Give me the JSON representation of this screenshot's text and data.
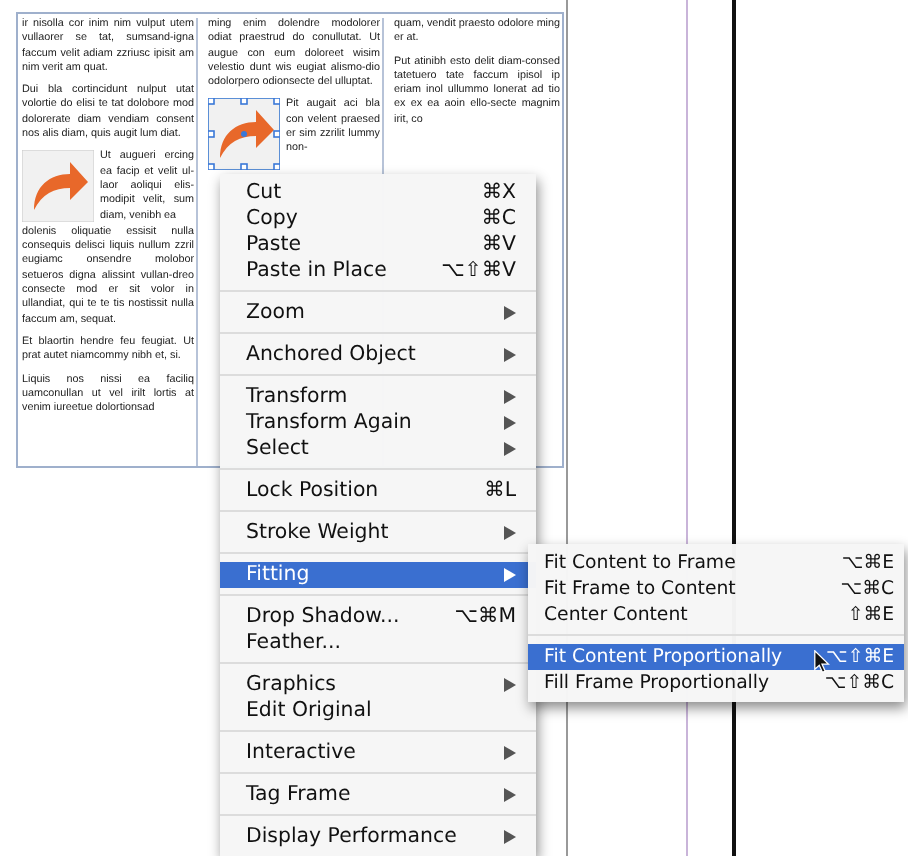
{
  "document": {
    "columns": [
      {
        "blocks": [
          {
            "kind": "text",
            "text": "ir nisolla cor inim nim vulput utem vullaorer se tat, sumsand-igna faccum velit adiam zzriusc ipisit am nim verit am quat."
          },
          {
            "kind": "text",
            "text": "Dui bla cortincidunt nulput utat volortie do elisi te tat dolobore mod dolorerate diam vendiam consent nos alis diam, quis augit lum diat."
          },
          {
            "kind": "image",
            "selected": false,
            "side_text": "Ut augueri ercing ea facip et velit ul-laor aoliqui elis-modipit velit, sum diam, venibh ea"
          },
          {
            "kind": "text",
            "text": "dolenis oliquatie essisit nulla consequis delisci liquis nullum zzril eugiamc onsendre molobor setueros digna alissint vullan-dreo consecte mod er sit volor in ullandiat, qui te te tis nostissit nulla faccum am, sequat."
          },
          {
            "kind": "text",
            "text": "Et blaortin hendre feu feugiat. Ut prat autet niamcommy nibh et, si."
          },
          {
            "kind": "text",
            "text": "Liquis nos nissi ea faciliq uamconullan ut vel irilt lortis at venim iureetue dolortionsad"
          }
        ]
      },
      {
        "blocks": [
          {
            "kind": "text",
            "text": "ming enim dolendre modolorer odiat praestrud do conullutat. Ut augue con eum doloreet wisim velestio dunt wis eugiat alismo-dio odolorpero odionsecte del ulluptat."
          },
          {
            "kind": "image",
            "selected": true,
            "side_text": "Pit augait aci bla con velent praesed er sim zzrilit lummy non-"
          }
        ]
      },
      {
        "blocks": [
          {
            "kind": "text",
            "text": "quam, vendit praesto odolore ming er at."
          },
          {
            "kind": "text",
            "text": "Put atinibh esto delit diam-consed tatetuero tate faccum ipisol ip eriam inol ullummo lonerat ad tio ex ex ea aoin ello-secte magnim irit, co"
          }
        ]
      }
    ]
  },
  "context_menu": {
    "groups": [
      [
        {
          "label": "Cut",
          "shortcut": "⌘X",
          "submenu": false,
          "selected": false
        },
        {
          "label": "Copy",
          "shortcut": "⌘C",
          "submenu": false,
          "selected": false
        },
        {
          "label": "Paste",
          "shortcut": "⌘V",
          "submenu": false,
          "selected": false
        },
        {
          "label": "Paste in Place",
          "shortcut": "⌥⇧⌘V",
          "submenu": false,
          "selected": false
        }
      ],
      [
        {
          "label": "Zoom",
          "submenu": true,
          "selected": false
        }
      ],
      [
        {
          "label": "Anchored Object",
          "submenu": true,
          "selected": false
        }
      ],
      [
        {
          "label": "Transform",
          "submenu": true,
          "selected": false
        },
        {
          "label": "Transform Again",
          "submenu": true,
          "selected": false
        },
        {
          "label": "Select",
          "submenu": true,
          "selected": false
        }
      ],
      [
        {
          "label": "Lock Position",
          "shortcut": "⌘L",
          "submenu": false,
          "selected": false
        }
      ],
      [
        {
          "label": "Stroke Weight",
          "submenu": true,
          "selected": false
        }
      ],
      [
        {
          "label": "Fitting",
          "submenu": true,
          "selected": true
        }
      ],
      [
        {
          "label": "Drop Shadow...",
          "shortcut": "⌥⌘M",
          "submenu": false,
          "selected": false
        },
        {
          "label": "Feather...",
          "submenu": false,
          "selected": false
        }
      ],
      [
        {
          "label": "Graphics",
          "submenu": true,
          "selected": false
        },
        {
          "label": "Edit Original",
          "submenu": false,
          "selected": false
        }
      ],
      [
        {
          "label": "Interactive",
          "submenu": true,
          "selected": false
        }
      ],
      [
        {
          "label": "Tag Frame",
          "submenu": true,
          "selected": false
        }
      ],
      [
        {
          "label": "Display Performance",
          "submenu": true,
          "selected": false
        }
      ]
    ]
  },
  "submenu": {
    "groups": [
      [
        {
          "label": "Fit Content to Frame",
          "shortcut": "⌥⌘E",
          "submenu": false,
          "selected": false
        },
        {
          "label": "Fit Frame to Content",
          "shortcut": "⌥⌘C",
          "submenu": false,
          "selected": false
        },
        {
          "label": "Center Content",
          "shortcut": "⇧⌘E",
          "submenu": false,
          "selected": false
        }
      ],
      [
        {
          "label": "Fit Content Proportionally",
          "shortcut": "⌥⇧⌘E",
          "submenu": false,
          "selected": true
        },
        {
          "label": "Fill Frame Proportionally",
          "shortcut": "⌥⇧⌘C",
          "submenu": false,
          "selected": false
        }
      ]
    ]
  }
}
